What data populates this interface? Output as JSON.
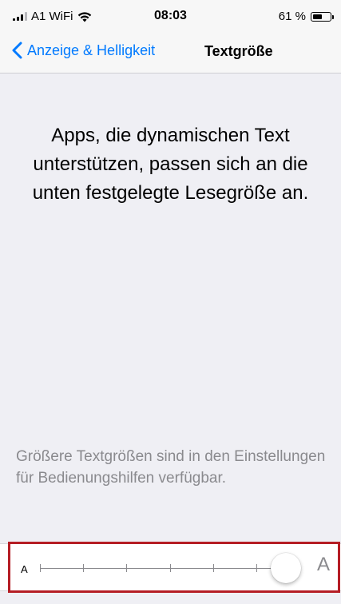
{
  "status_bar": {
    "carrier": "A1 WiFi",
    "time": "08:03",
    "battery_percent": "61 %",
    "battery_level": 0.61,
    "icons": [
      "signal-icon",
      "wifi-icon",
      "battery-icon"
    ]
  },
  "nav": {
    "back_label": "Anzeige & Helligkeit",
    "title": "Textgröße"
  },
  "content": {
    "preview_text": "Apps, die dynamischen Text unterstützen, passen sich an die unten festgelegte Lesegröße an.",
    "info_text": "Größere Textgrößen sind in den Einstellungen für Bedienungshilfen verfügbar."
  },
  "slider": {
    "min_label": "A",
    "max_label": "A",
    "steps": 7,
    "selected_step": 7
  },
  "colors": {
    "accent": "#007aff",
    "highlight_border": "#b51d24",
    "background": "#efeff4",
    "secondary_text": "#8a8a8e"
  }
}
